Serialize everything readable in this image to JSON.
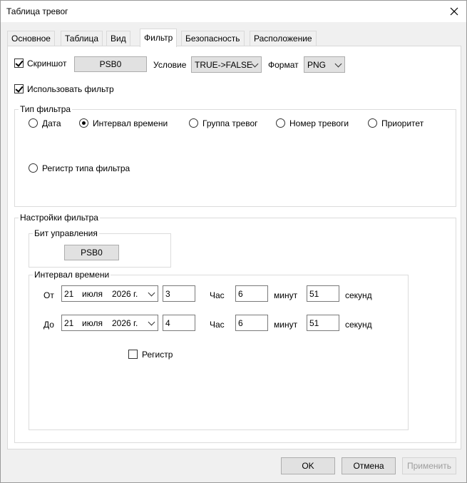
{
  "window": {
    "title": "Таблица тревог"
  },
  "tabs": [
    {
      "label": "Основное"
    },
    {
      "label": "Таблица"
    },
    {
      "label": "Вид"
    },
    {
      "label": "Фильтр",
      "active": true
    },
    {
      "label": "Безопасность"
    },
    {
      "label": "Расположение"
    }
  ],
  "top_row": {
    "screenshot_label": "Скриншот",
    "screenshot_checked": true,
    "screenshot_button": "PSB0",
    "condition_label": "Условие",
    "condition_value": "TRUE->FALSE",
    "format_label": "Формат",
    "format_value": "PNG"
  },
  "use_filter": {
    "label": "Использовать фильтр",
    "checked": true
  },
  "filter_type": {
    "title": "Тип фильтра",
    "options": [
      "Дата",
      "Интервал времени",
      "Группа тревог",
      "Номер тревоги",
      "Приоритет",
      "Регистр типа фильтра"
    ],
    "selected": "Интервал времени"
  },
  "filter_settings": {
    "title": "Настройки фильтра",
    "control_bit": {
      "title": "Бит управления",
      "button": "PSB0"
    },
    "time_interval": {
      "title": "Интервал времени",
      "from": {
        "label": "От",
        "day": "21",
        "month": "июля",
        "year": "2026 г.",
        "hour": "3",
        "hour_label": "Час",
        "minute": "6",
        "minute_label": "минут",
        "second": "51",
        "second_label": "секунд"
      },
      "to": {
        "label": "До",
        "day": "21",
        "month": "июля",
        "year": "2026 г.",
        "hour": "4",
        "hour_label": "Час",
        "minute": "6",
        "minute_label": "минут",
        "second": "51",
        "second_label": "секунд"
      },
      "register_label": "Регистр",
      "register_checked": false
    }
  },
  "footer": {
    "ok": "OK",
    "cancel": "Отмена",
    "apply": "Применить"
  }
}
